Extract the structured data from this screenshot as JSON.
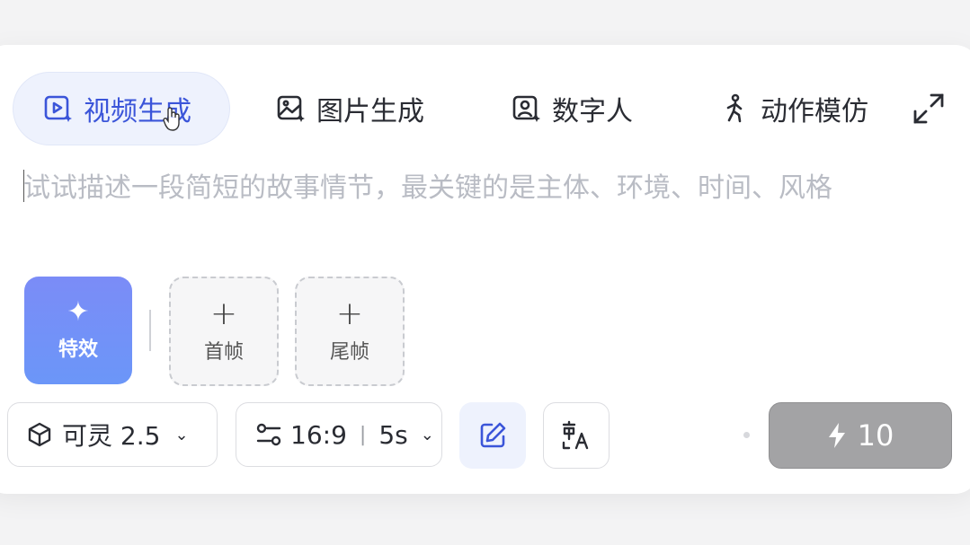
{
  "tabs": [
    {
      "label": "视频生成",
      "icon": "video-spark-icon",
      "active": true
    },
    {
      "label": "图片生成",
      "icon": "image-spark-icon",
      "active": false
    },
    {
      "label": "数字人",
      "icon": "avatar-spark-icon",
      "active": false
    },
    {
      "label": "动作模仿",
      "icon": "running-person-icon",
      "active": false
    }
  ],
  "prompt": {
    "value": "",
    "placeholder": "试试描述一段简短的故事情节，最关键的是主体、环境、时间、风格"
  },
  "effects_button": {
    "label": "特效",
    "icon": "sparkle-icon"
  },
  "frames": {
    "first_label": "首帧",
    "last_label": "尾帧"
  },
  "toolbar": {
    "model_label": "可灵 2.5",
    "aspect_ratio": "16:9",
    "separator": "|",
    "duration": "5s",
    "generate_cost": "10"
  },
  "colors": {
    "accent": "#3b55d9",
    "active_tab_bg": "#eef2fd",
    "effects_gradient_start": "#7b8cf7",
    "effects_gradient_end": "#6b96f8",
    "generate_bg": "#a3a3a5"
  }
}
